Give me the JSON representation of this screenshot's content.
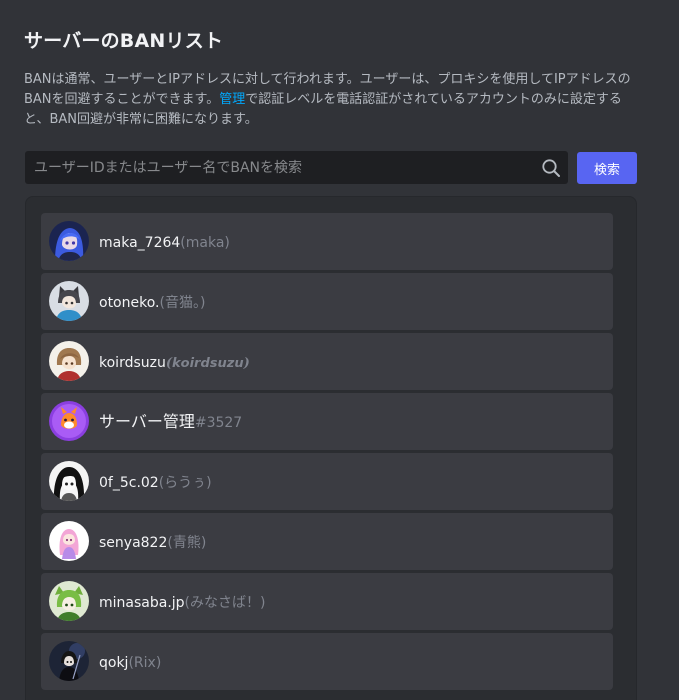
{
  "header": {
    "title": "サーバーのBANリスト"
  },
  "description": {
    "before_link": "BANは通常、ユーザーとIPアドレスに対して行われます。ユーザーは、プロキシを使用してIPアドレスのBANを回避することができます。",
    "link": "管理",
    "after_link": "で認証レベルを電話認証がされているアカウントのみに設定すると、BAN回避が非常に困難になります。"
  },
  "search": {
    "placeholder": "ユーザーIDまたはユーザー名でBANを検索",
    "value": "",
    "icon": "search-icon",
    "button_label": "検索"
  },
  "colors": {
    "background": "#313338",
    "panel": "#2b2d31",
    "item": "#3b3c42",
    "accent": "#5865f2",
    "link": "#00a8fc",
    "muted": "#80848e"
  },
  "bans": [
    {
      "username": "maka_7264",
      "display": "(maka)",
      "avatar": "avatar-blue-hair"
    },
    {
      "username": "otoneko.",
      "display": "(音猫。)",
      "avatar": "avatar-cat-ears"
    },
    {
      "username": "koirdsuzu",
      "display": "(𝙠𝙤𝙞𝙧𝙙𝙨𝙪𝙯𝙪)",
      "avatar": "avatar-brown-hair"
    },
    {
      "username": "サーバー管理",
      "display": "#3527",
      "avatar": "avatar-purple-bot"
    },
    {
      "username": "0f_5c.02",
      "display": "(らうぅ)",
      "avatar": "avatar-monochrome"
    },
    {
      "username": "senya822",
      "display": "(青熊)",
      "avatar": "avatar-pink-hair"
    },
    {
      "username": "minasaba.jp",
      "display": "(みなさば！)",
      "avatar": "avatar-green-character"
    },
    {
      "username": "qokj",
      "display": "(Rix)",
      "avatar": "avatar-dark-character"
    }
  ]
}
